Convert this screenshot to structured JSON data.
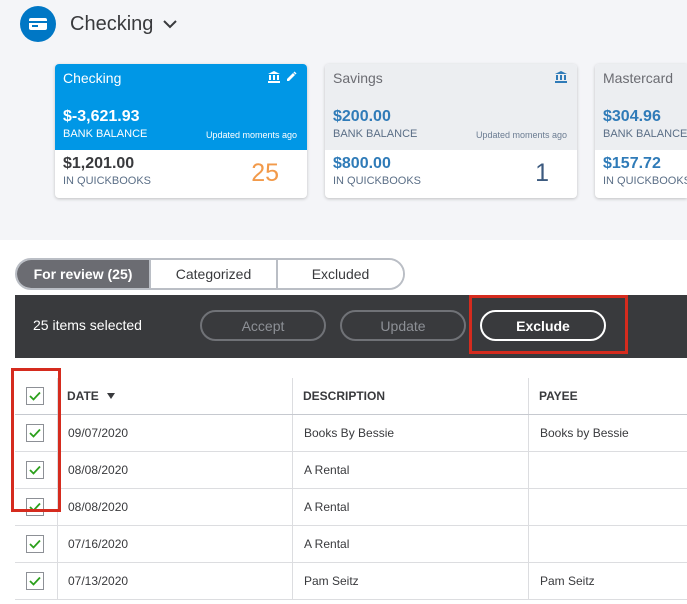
{
  "account": {
    "title": "Checking"
  },
  "cards": [
    {
      "name": "Checking",
      "bank_balance": "$-3,621.93",
      "bank_label": "BANK BALANCE",
      "updated": "Updated moments ago",
      "qb_balance": "$1,201.00",
      "qb_label": "IN QUICKBOOKS",
      "count": "25"
    },
    {
      "name": "Savings",
      "bank_balance": "$200.00",
      "bank_label": "BANK BALANCE",
      "updated": "Updated moments ago",
      "qb_balance": "$800.00",
      "qb_label": "IN QUICKBOOKS",
      "count": "1"
    },
    {
      "name": "Mastercard",
      "bank_balance": "$304.96",
      "bank_label": "BANK BALANCE",
      "updated": "",
      "qb_balance": "$157.72",
      "qb_label": "IN QUICKBOOKS",
      "count": ""
    }
  ],
  "tabs": [
    {
      "label": "For review (25)"
    },
    {
      "label": "Categorized"
    },
    {
      "label": "Excluded"
    }
  ],
  "batch": {
    "selected_text": "25 items selected",
    "accept_label": "Accept",
    "update_label": "Update",
    "exclude_label": "Exclude"
  },
  "table": {
    "headers": {
      "date": "DATE",
      "description": "DESCRIPTION",
      "payee": "PAYEE"
    },
    "rows": [
      {
        "date": "09/07/2020",
        "description": "Books By Bessie",
        "payee": "Books by Bessie"
      },
      {
        "date": "08/08/2020",
        "description": "A Rental",
        "payee": ""
      },
      {
        "date": "08/08/2020",
        "description": "A Rental",
        "payee": ""
      },
      {
        "date": "07/16/2020",
        "description": "A Rental",
        "payee": ""
      },
      {
        "date": "07/13/2020",
        "description": "Pam Seitz",
        "payee": "Pam Seitz"
      }
    ]
  },
  "colors": {
    "brand_blue": "#0077c5",
    "active_card": "#0097e6",
    "checkmark_green": "#2ca01c",
    "highlight_red": "#d52b1e",
    "count_orange": "#f29a4a"
  },
  "icons": {
    "account": "bank-card-icon",
    "chevron": "chevron-down-icon",
    "bank": "bank-icon",
    "edit": "pencil-icon",
    "check": "checkmark-icon"
  }
}
